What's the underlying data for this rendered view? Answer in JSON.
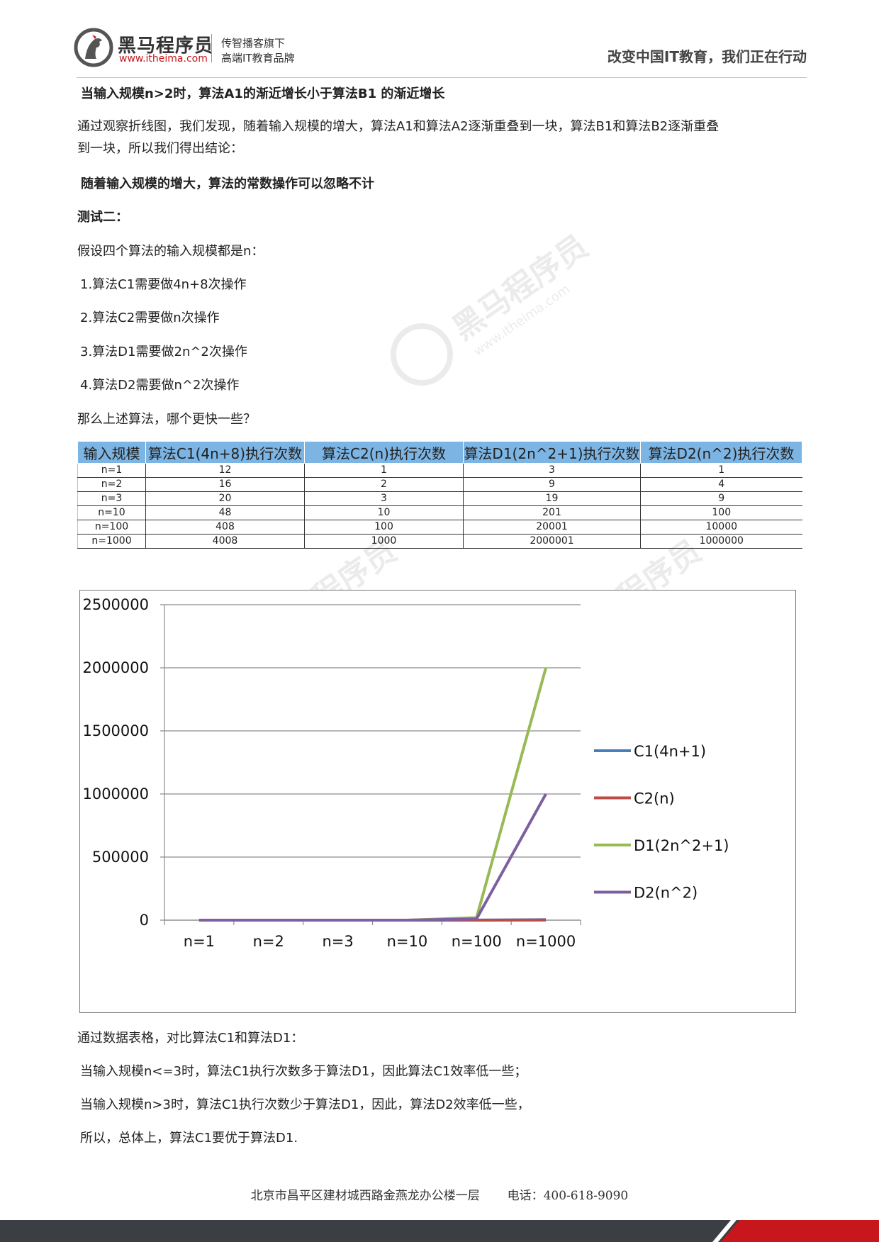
{
  "header": {
    "brand_cn": "黑马程序员",
    "brand_url": "www.itheima.com",
    "sub1": "传智播客旗下",
    "sub2": "高端IT教育品牌",
    "slogan": "改变中国IT教育，我们正在行动"
  },
  "body": {
    "heading1": "当输入规模n>2时，算法A1的渐近增长小于算法B1 的渐近增长",
    "para1_line1": "通过观察折线图，我们发现，随着输入规模的增大，算法A1和算法A2逐渐重叠到一块，算法B1和算法B2逐渐重叠",
    "para1_line2": "到一块，所以我们得出结论：",
    "heading2": "随着输入规模的增大，算法的常数操作可以忽略不计",
    "heading3": "测试二：",
    "intro": "假设四个算法的输入规模都是n：",
    "items": [
      "1.算法C1需要做4n+8次操作",
      "2.算法C2需要做n次操作",
      "3.算法D1需要做2n^2次操作",
      "4.算法D2需要做n^2次操作"
    ],
    "question": "那么上述算法，哪个更快一些？",
    "conclusion_intro": "通过数据表格，对比算法C1和算法D1：",
    "conclusion1": "当输入规模n<=3时，算法C1执行次数多于算法D1，因此算法C1效率低一些；",
    "conclusion2": "当输入规模n>3时，算法C1执行次数少于算法D1，因此，算法D2效率低一些，",
    "conclusion3": "所以，总体上，算法C1要优于算法D1."
  },
  "table": {
    "headers": [
      "输入规模",
      "算法C1(4n+8)执行次数",
      "算法C2(n)执行次数",
      "算法D1(2n^2+1)执行次数",
      "算法D2(n^2)执行次数"
    ],
    "rows": [
      [
        "n=1",
        "12",
        "1",
        "3",
        "1"
      ],
      [
        "n=2",
        "16",
        "2",
        "9",
        "4"
      ],
      [
        "n=3",
        "20",
        "3",
        "19",
        "9"
      ],
      [
        "n=10",
        "48",
        "10",
        "201",
        "100"
      ],
      [
        "n=100",
        "408",
        "100",
        "20001",
        "10000"
      ],
      [
        "n=1000",
        "4008",
        "1000",
        "2000001",
        "1000000"
      ]
    ]
  },
  "chart_data": {
    "type": "line",
    "categories": [
      "n=1",
      "n=2",
      "n=3",
      "n=10",
      "n=100",
      "n=1000"
    ],
    "ylim": [
      0,
      2500000
    ],
    "yticks": [
      "0",
      "500000",
      "1000000",
      "1500000",
      "2000000",
      "2500000"
    ],
    "grid": true,
    "legend": "right",
    "series": [
      {
        "name": "C1(4n+1)",
        "color": "#4a7ebb",
        "values": [
          12,
          16,
          20,
          48,
          408,
          4008
        ]
      },
      {
        "name": "C2(n)",
        "color": "#be4b48",
        "values": [
          1,
          2,
          3,
          10,
          100,
          1000
        ]
      },
      {
        "name": "D1(2n^2+1)",
        "color": "#98b954",
        "values": [
          3,
          9,
          19,
          201,
          20001,
          2000001
        ]
      },
      {
        "name": "D2(n^2)",
        "color": "#7d5fa0",
        "values": [
          1,
          4,
          9,
          100,
          10000,
          1000000
        ]
      }
    ]
  },
  "watermark": {
    "brand": "黑马程序员",
    "url": "www.itheima.com"
  },
  "footer": {
    "address": "北京市昌平区建材城西路金燕龙办公楼一层",
    "phone": "电话：400-618-9090"
  }
}
